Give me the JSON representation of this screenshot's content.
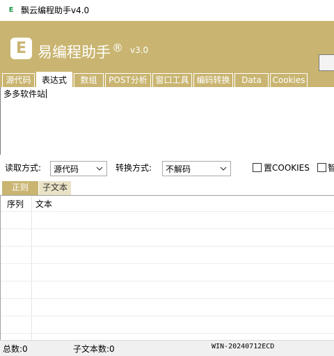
{
  "window": {
    "title": "飘云编程助手v4.0",
    "icon": "app-icon"
  },
  "banner": {
    "logo_letter": "E",
    "brand": "易编程助手",
    "brand_mark": "®",
    "version": "v3.0",
    "accent_color": "#c9b571"
  },
  "tabs": [
    {
      "label": "源代码",
      "active": false
    },
    {
      "label": "表达式",
      "active": true
    },
    {
      "label": "数组",
      "active": false
    },
    {
      "label": "POST分析",
      "active": false
    },
    {
      "label": "窗口工具",
      "active": false
    },
    {
      "label": "编码转换",
      "active": false
    },
    {
      "label": "Data",
      "active": false
    },
    {
      "label": "Cookies",
      "active": false
    }
  ],
  "editor": {
    "content": "多多软件站"
  },
  "options": {
    "read_label": "读取方式:",
    "read_value": "源代码",
    "convert_label": "转换方式:",
    "convert_value": "不解码",
    "cookie_checkbox_label": "置COOKIES",
    "cookie_checked": false,
    "second_checkbox_label": "智",
    "second_checked": false
  },
  "subtabs": [
    {
      "label": "正则",
      "active": true
    },
    {
      "label": "子文本",
      "active": false
    }
  ],
  "grid": {
    "columns": [
      "序列",
      "文本"
    ],
    "rows": []
  },
  "status": {
    "total": "总数:0",
    "subtext_count": "子文本数:0",
    "machine": "WIN-20240712ECD"
  }
}
